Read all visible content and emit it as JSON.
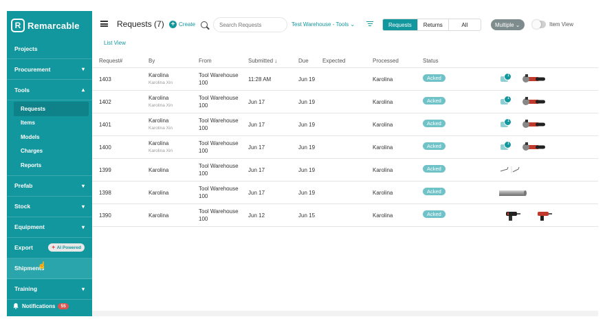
{
  "brand": {
    "name": "Remarcable",
    "mark": "R"
  },
  "sidebar": {
    "items": [
      {
        "label": "Projects",
        "chevron": ""
      },
      {
        "label": "Procurement",
        "chevron": "▾"
      },
      {
        "label": "Tools",
        "chevron": "▴"
      }
    ],
    "tools_sub": [
      "Requests",
      "Items",
      "Models",
      "Charges",
      "Reports"
    ],
    "items_after": [
      {
        "label": "Prefab",
        "chevron": "▾"
      },
      {
        "label": "Stock",
        "chevron": "▾"
      },
      {
        "label": "Equipment",
        "chevron": "▾"
      },
      {
        "label": "Export",
        "chevron": ""
      },
      {
        "label": "Shipments",
        "chevron": ""
      },
      {
        "label": "Training",
        "chevron": "▾"
      }
    ],
    "ai_badge": "AI Powered",
    "notifications_label": "Notifications",
    "notifications_count": "55"
  },
  "header": {
    "title": "Requests (7)",
    "create_label": "Create",
    "search_placeholder": "Search Requests",
    "location": "Test Warehouse - Tools ⌄",
    "segments": [
      "Requests",
      "Returns",
      "All"
    ],
    "multiple": "Multiple ⌄",
    "item_view": "Item View"
  },
  "list_view": "List View",
  "table": {
    "columns": [
      "Request#",
      "By",
      "From",
      "Submitted ↓",
      "Due",
      "Expected",
      "Processed",
      "Status"
    ],
    "rows": [
      {
        "id": "1403",
        "by": "Karolina",
        "by_sub": "Karolina Xin",
        "from1": "Tool Warehouse",
        "from2": "100",
        "submitted": "11:28 AM",
        "due": "Jun 19",
        "expected": "",
        "processed": "Karolina",
        "status": "Acked",
        "chat_count": "1",
        "thumbs": [
          "grinder"
        ]
      },
      {
        "id": "1402",
        "by": "Karolina",
        "by_sub": "Karolina Xin",
        "from1": "Tool Warehouse",
        "from2": "100",
        "submitted": "Jun 17",
        "due": "Jun 19",
        "expected": "",
        "processed": "Karolina",
        "status": "Acked",
        "chat_count": "1",
        "thumbs": [
          "grinder"
        ]
      },
      {
        "id": "1401",
        "by": "Karolina",
        "by_sub": "Karolina Xin",
        "from1": "Tool Warehouse",
        "from2": "100",
        "submitted": "Jun 17",
        "due": "Jun 19",
        "expected": "",
        "processed": "Karolina",
        "status": "Acked",
        "chat_count": "1",
        "thumbs": [
          "grinder"
        ]
      },
      {
        "id": "1400",
        "by": "Karolina",
        "by_sub": "Karolina Xin",
        "from1": "Tool Warehouse",
        "from2": "100",
        "submitted": "Jun 17",
        "due": "Jun 19",
        "expected": "",
        "processed": "Karolina",
        "status": "Acked",
        "chat_count": "1",
        "thumbs": [
          "grinder"
        ]
      },
      {
        "id": "1399",
        "by": "Karolina",
        "by_sub": "",
        "from1": "Tool Warehouse",
        "from2": "100",
        "submitted": "Jun 17",
        "due": "Jun 19",
        "expected": "",
        "processed": "Karolina",
        "status": "Acked",
        "chat_count": "",
        "thumbs": [
          "hook"
        ]
      },
      {
        "id": "1398",
        "by": "Karolina",
        "by_sub": "",
        "from1": "Tool Warehouse",
        "from2": "100",
        "submitted": "Jun 17",
        "due": "Jun 19",
        "expected": "",
        "processed": "Karolina",
        "status": "Acked",
        "chat_count": "",
        "thumbs": [
          "pipe"
        ]
      },
      {
        "id": "1390",
        "by": "Karolina",
        "by_sub": "",
        "from1": "Tool Warehouse",
        "from2": "100",
        "submitted": "Jun 12",
        "due": "Jun 15",
        "expected": "",
        "processed": "Karolina",
        "status": "Acked",
        "chat_count": "",
        "thumbs": [
          "drill-black",
          "drill-red"
        ]
      }
    ]
  },
  "colors": {
    "brand": "#12979e",
    "badge": "#6fc3c8",
    "alert": "#d9534f"
  }
}
